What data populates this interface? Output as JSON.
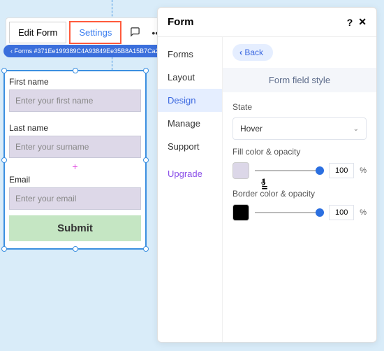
{
  "toolbar": {
    "edit_label": "Edit Form",
    "settings_label": "Settings"
  },
  "breadcrumb": "Forms #371Ee199389C4A93849Ee35B8A15B7Ca2",
  "form": {
    "fields": [
      {
        "label": "First name",
        "placeholder": "Enter your first name"
      },
      {
        "label": "Last name",
        "placeholder": "Enter your surname"
      },
      {
        "label": "Email",
        "placeholder": "Enter your email"
      }
    ],
    "submit_label": "Submit"
  },
  "panel": {
    "title": "Form",
    "nav": {
      "items": [
        "Forms",
        "Layout",
        "Design",
        "Manage",
        "Support"
      ],
      "upgrade": "Upgrade"
    },
    "back_label": "Back",
    "section_title": "Form field style",
    "state_label": "State",
    "state_value": "Hover",
    "fill_label": "Fill color & opacity",
    "fill_opacity": "100",
    "border_label": "Border color & opacity",
    "border_opacity": "100",
    "percent_symbol": "%"
  }
}
